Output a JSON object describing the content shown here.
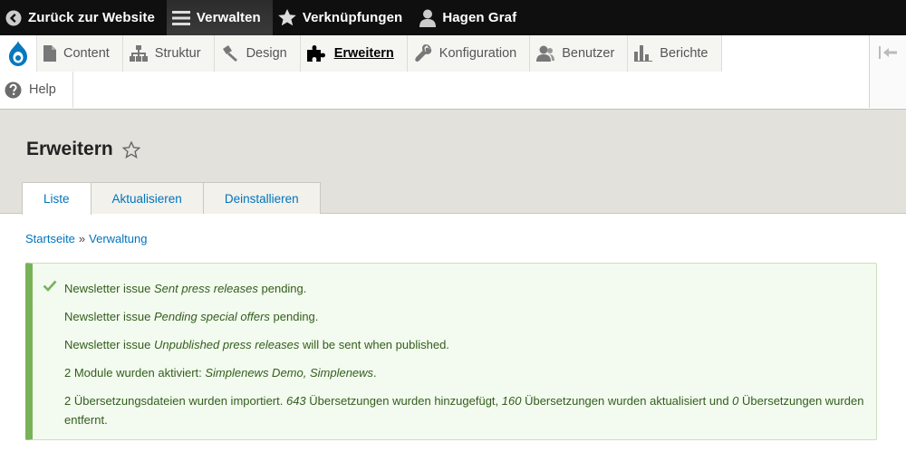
{
  "toolbar": {
    "back_label": "Zurück zur Website",
    "manage_label": "Verwalten",
    "shortcuts_label": "Verknüpfungen",
    "user_label": "Hagen Graf"
  },
  "tray": {
    "items": [
      {
        "label": "Content"
      },
      {
        "label": "Struktur"
      },
      {
        "label": "Design"
      },
      {
        "label": "Erweitern"
      },
      {
        "label": "Konfiguration"
      },
      {
        "label": "Benutzer"
      },
      {
        "label": "Berichte"
      }
    ],
    "help_label": "Help"
  },
  "page": {
    "title": "Erweitern"
  },
  "tabs": [
    {
      "label": "Liste"
    },
    {
      "label": "Aktualisieren"
    },
    {
      "label": "Deinstallieren"
    }
  ],
  "breadcrumb": {
    "home": "Startseite",
    "separator": "»",
    "admin": "Verwaltung"
  },
  "messages": [
    {
      "pre": "Newsletter issue ",
      "em": "Sent press releases",
      "post": " pending."
    },
    {
      "pre": "Newsletter issue ",
      "em": "Pending special offers",
      "post": " pending."
    },
    {
      "pre": "Newsletter issue ",
      "em": "Unpublished press releases",
      "post": " will be sent when published."
    },
    {
      "pre": "2 Module wurden aktiviert: ",
      "em": "Simplenews Demo, Simplenews",
      "post": "."
    },
    {
      "pre": "2 Übersetzungsdateien wurden importiert. ",
      "em1": "643",
      "mid1": " Übersetzungen wurden hinzugefügt, ",
      "em2": "160",
      "mid2": " Übersetzungen wurden aktualisiert und ",
      "em3": "0",
      "post": " Übersetzungen wurden entfernt."
    }
  ],
  "colors": {
    "toolbar_bg": "#0f0f0f",
    "link": "#0074bd",
    "status_border": "#77b259",
    "status_text": "#325e1c",
    "header_bg": "#e2e1dc"
  }
}
